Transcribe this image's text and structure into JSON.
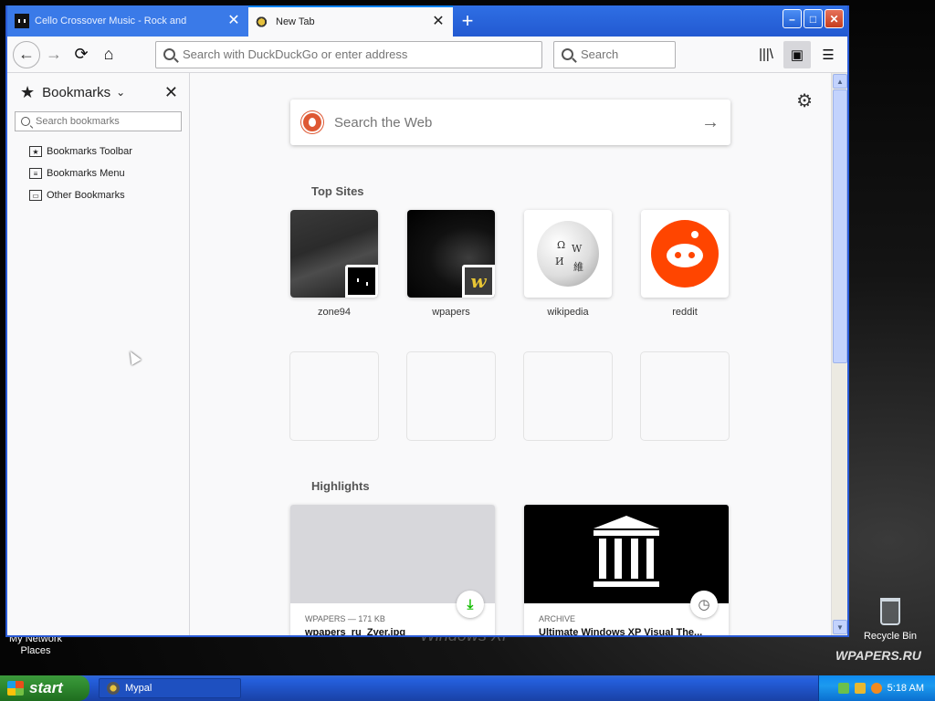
{
  "tabs": [
    {
      "title": "Cello Crossover Music - Rock and",
      "active": false
    },
    {
      "title": "New Tab",
      "active": true
    }
  ],
  "new_tab_symbol": "+",
  "window_controls": {
    "minimize": "–",
    "maximize": "□",
    "close": "✕"
  },
  "navbar": {
    "back": "←",
    "forward": "→",
    "reload": "⟳",
    "home": "⌂",
    "url_placeholder": "Search with DuckDuckGo or enter address",
    "search_placeholder": "Search",
    "library": "|||\\",
    "sidebar": "▣",
    "menu": "☰"
  },
  "sidebar": {
    "title": "Bookmarks",
    "search_placeholder": "Search bookmarks",
    "items": [
      {
        "label": "Bookmarks Toolbar",
        "icon": "bookmarks-toolbar-icon"
      },
      {
        "label": "Bookmarks Menu",
        "icon": "bookmarks-menu-icon"
      },
      {
        "label": "Other Bookmarks",
        "icon": "other-bookmarks-icon"
      }
    ]
  },
  "newtab": {
    "search_placeholder": "Search the Web",
    "top_sites_title": "Top Sites",
    "top_sites": [
      {
        "label": "zone94"
      },
      {
        "label": "wpapers"
      },
      {
        "label": "wikipedia"
      },
      {
        "label": "reddit"
      }
    ],
    "highlights_title": "Highlights",
    "highlights": [
      {
        "meta": "WPAPERS — 171 KB",
        "title": "wpapers_ru_Zver.jpg",
        "badge": "download-icon"
      },
      {
        "meta": "ARCHIVE",
        "title": "Ultimate Windows XP Visual The...",
        "badge": "clock-icon"
      }
    ]
  },
  "desktop": {
    "network_places": "My Network Places",
    "recycle_bin": "Recycle Bin",
    "watermark": "Windows XP",
    "site_logo": "WPAPERS.RU"
  },
  "taskbar": {
    "start_label": "start",
    "task_item": "Mypal",
    "clock": "5:18 AM"
  },
  "colors": {
    "accent": "#0a84ff",
    "xp_blue": "#245edb",
    "reddit": "#ff4500",
    "ddg": "#de5833"
  }
}
